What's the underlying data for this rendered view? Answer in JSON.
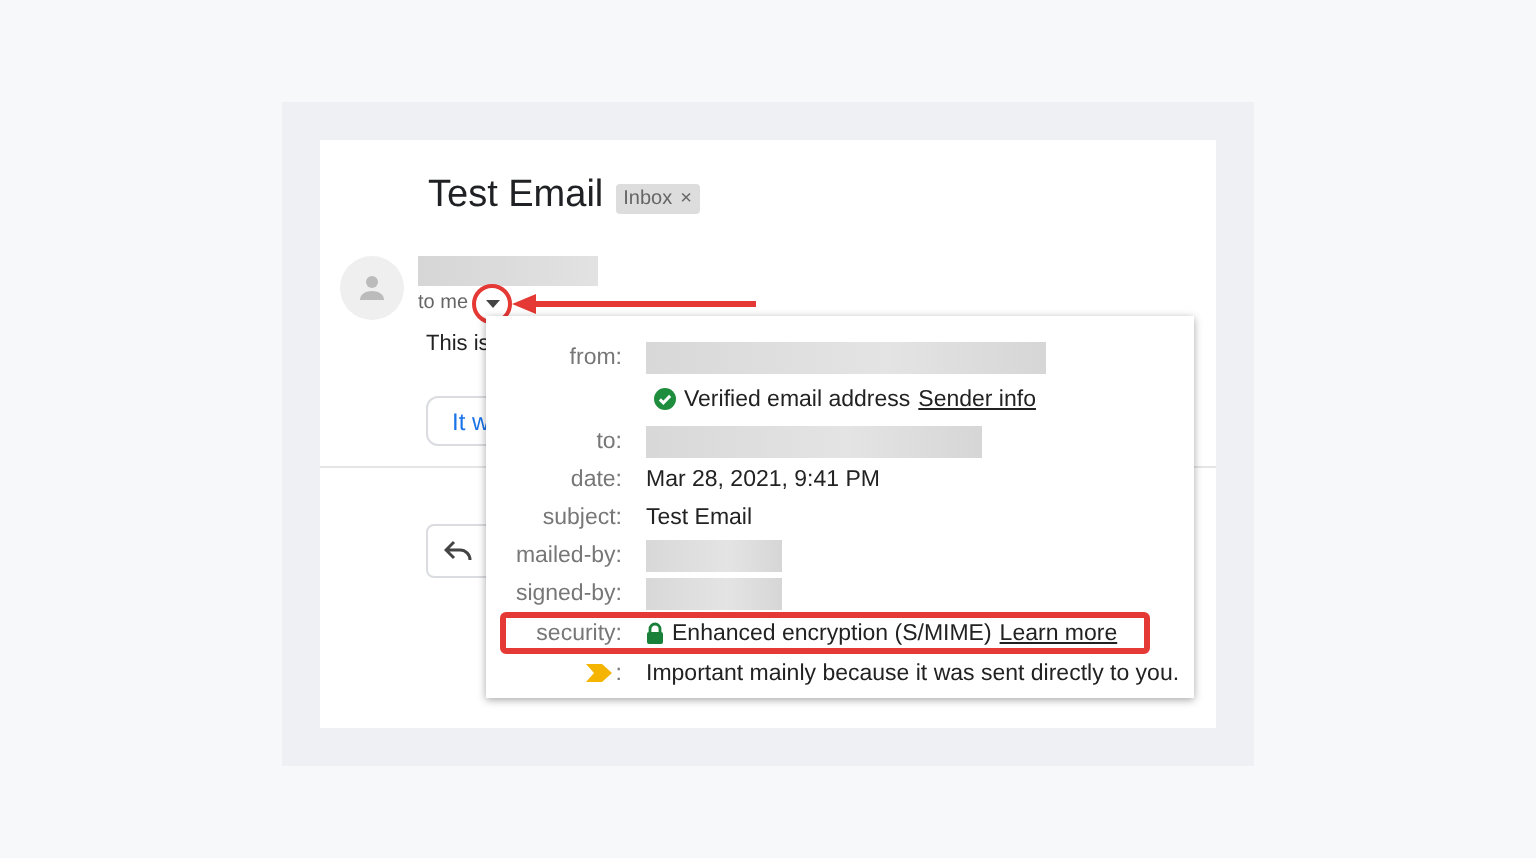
{
  "title": "Test Email",
  "label_chip": {
    "text": "Inbox",
    "close": "×"
  },
  "recipient": "to me",
  "body_preview": "This is",
  "smart_reply": "It w",
  "details": {
    "rows": [
      {
        "kind": "redacted",
        "label": "from:"
      },
      {
        "kind": "verified",
        "text": "Verified email address",
        "link": "Sender info"
      },
      {
        "kind": "redacted",
        "label": "to:"
      },
      {
        "kind": "text",
        "label": "date:",
        "value": "Mar 28, 2021, 9:41 PM"
      },
      {
        "kind": "text",
        "label": "subject:",
        "value": "Test Email"
      },
      {
        "kind": "redacted",
        "label": "mailed-by:"
      },
      {
        "kind": "redacted",
        "label": "signed-by:"
      },
      {
        "kind": "security",
        "label": "security:",
        "value": "Enhanced encryption (S/MIME)",
        "link": "Learn more",
        "highlighted": true
      },
      {
        "kind": "importance",
        "label": ":",
        "value": "Important mainly because it was sent directly to you."
      }
    ]
  }
}
